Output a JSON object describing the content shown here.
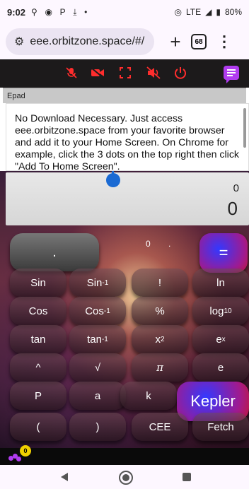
{
  "status_bar": {
    "time": "9:02",
    "network": "LTE",
    "battery": "80%"
  },
  "browser": {
    "url": "eee.orbitzone.space/#/",
    "new_tab": "+",
    "tab_count": "68",
    "menu": "⋮"
  },
  "toolbar": {
    "icons": [
      "mic-off-icon",
      "camera-off-icon",
      "fullscreen-icon",
      "speaker-off-icon",
      "power-icon",
      "chat-icon"
    ],
    "accent_color": "#ff2d2d",
    "chat_color": "#b13cf0"
  },
  "epad": {
    "title": "Epad",
    "text": "No Download Necessary. Just access eee.orbitzone.space from your favorite browser and add it to your Home Screen. On Chrome for example, click the 3 dots on the top right then click \"Add To Home Screen\"."
  },
  "calculator": {
    "display_small": "0",
    "display_main": "0",
    "memory_label": ".",
    "mini_zero": "0",
    "mini_dot": ".",
    "equals": "=",
    "keys": {
      "sin": "Sin",
      "sin_inv_base": "Sin",
      "sin_inv_exp": "-1",
      "fact": "!",
      "ln": "ln",
      "cos": "Cos",
      "cos_inv_base": "Cos",
      "cos_inv_exp": "-1",
      "pct": "%",
      "log_base": "log",
      "log_sub": "10",
      "tan": "tan",
      "tan_inv_base": "tan",
      "tan_inv_exp": "-1",
      "x2_base": "x",
      "x2_exp": "2",
      "ex_base": "e",
      "ex_exp": "x",
      "caret": "^",
      "sqrt": "√",
      "pi": "π",
      "e": "e",
      "p": "P",
      "a": "a",
      "k": "k",
      "kepler": "Kepler",
      "lparen": "(",
      "rparen": ")",
      "cee": "CEE",
      "fetch": "Fetch"
    }
  },
  "bottom_bar": {
    "badge": "0"
  }
}
